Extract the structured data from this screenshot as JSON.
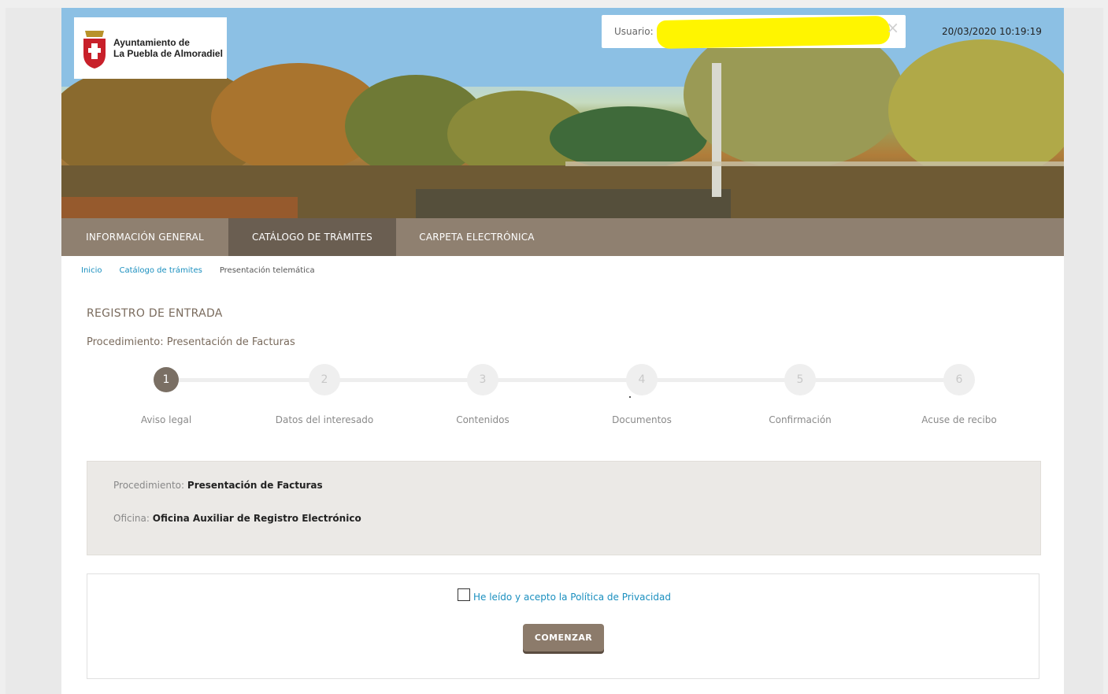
{
  "header": {
    "org_line1": "Ayuntamiento de",
    "org_line2": "La Puebla de Almoradiel",
    "user_label": "Usuario:",
    "datetime": "20/03/2020 10:19:19"
  },
  "nav": {
    "items": [
      {
        "label": "INFORMACIÓN GENERAL"
      },
      {
        "label": "CATÁLOGO DE TRÁMITES",
        "active": true
      },
      {
        "label": "CARPETA ELECTRÓNICA"
      }
    ]
  },
  "breadcrumb": {
    "items": [
      "Inicio",
      "Catálogo de trámites"
    ],
    "current": "Presentación telemática"
  },
  "page": {
    "title": "REGISTRO DE ENTRADA",
    "subtitle": "Procedimiento: Presentación de Facturas"
  },
  "steps": [
    {
      "number": "1",
      "label": "Aviso legal",
      "active": true
    },
    {
      "number": "2",
      "label": "Datos del interesado"
    },
    {
      "number": "3",
      "label": "Contenidos"
    },
    {
      "number": "4",
      "label": "Documentos"
    },
    {
      "number": "5",
      "label": "Confirmación"
    },
    {
      "number": "6",
      "label": "Acuse de recibo"
    }
  ],
  "info": {
    "procedimiento_label": "Procedimiento:",
    "procedimiento_value": "Presentación de Facturas",
    "oficina_label": "Oficina:",
    "oficina_value": "Oficina Auxiliar de Registro Electrónico"
  },
  "form": {
    "privacy_label": "He leído y acepto la Política de Privacidad",
    "privacy_checked": false,
    "start_button": "COMENZAR"
  },
  "colors": {
    "nav_bg": "#8f8070",
    "nav_active": "#6a5e51",
    "link": "#1a8fbf",
    "title": "#7a6b5d",
    "button": "#8c7b6b"
  }
}
